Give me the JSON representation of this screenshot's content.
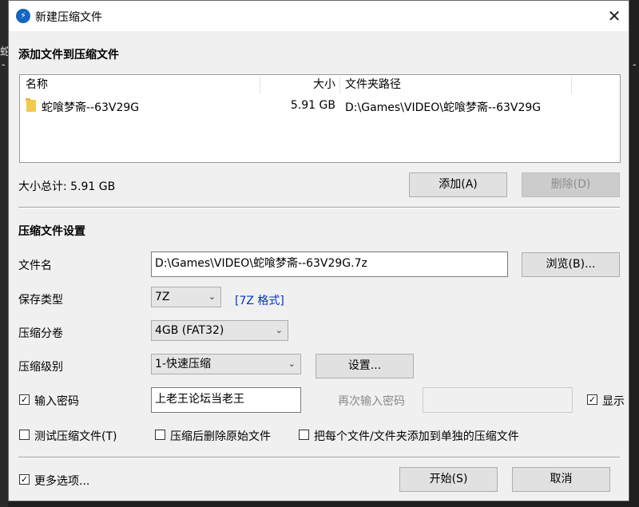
{
  "background": {
    "left_text_1": "蛇",
    "left_text_2": "-",
    "right_text": "-"
  },
  "window": {
    "title": "新建压缩文件",
    "close_glyph": "✕"
  },
  "add_section": {
    "title": "添加文件到压缩文件",
    "columns": [
      "名称",
      "大小",
      "文件夹路径"
    ],
    "rows": [
      {
        "name": "蛇喰梦斋--63V29G",
        "size": "5.91 GB",
        "path": "D:\\Games\\VIDEO\\蛇喰梦斋--63V29G"
      }
    ],
    "total_label": "大小总计: 5.91 GB",
    "add_button": "添加(A)",
    "delete_button": "删除(D)"
  },
  "settings": {
    "title": "压缩文件设置",
    "filename_label": "文件名",
    "filename_value": "D:\\Games\\VIDEO\\蛇喰梦斋--63V29G.7z",
    "browse_button": "浏览(B)...",
    "type_label": "保存类型",
    "type_value": "7Z",
    "type_link": "[7Z 格式]",
    "split_label": "压缩分卷",
    "split_value": "4GB (FAT32)",
    "level_label": "压缩级别",
    "level_value": "1-快速压缩",
    "settings_button": "设置...",
    "password_label": "输入密码",
    "password_value": "上老王论坛当老王",
    "reenter_label": "再次输入密码",
    "show_label": "显示",
    "test_label": "测试压缩文件(T)",
    "delete_after_label": "压缩后删除原始文件",
    "separate_label": "把每个文件/文件夹添加到单独的压缩文件"
  },
  "footer": {
    "more_options": "更多选项...",
    "start_button": "开始(S)",
    "cancel_button": "取消"
  },
  "checkbox_states": {
    "password": true,
    "show": true,
    "test": false,
    "delete_after": false,
    "separate": false,
    "more_options": true
  }
}
